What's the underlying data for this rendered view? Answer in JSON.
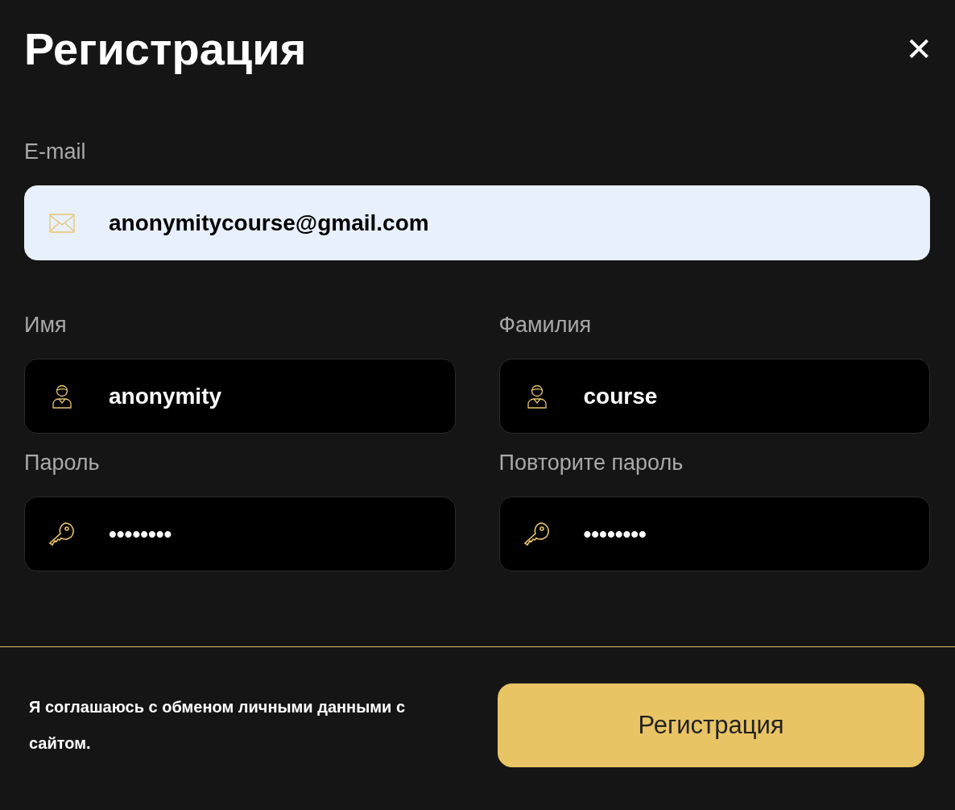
{
  "title": "Регистрация",
  "close": "✕",
  "fields": [
    {
      "label": "E-mail",
      "value": "anonymitycourse@gmail.com",
      "kind": "email",
      "autofilled": true
    },
    {
      "label": "Имя",
      "value": "anonymity",
      "kind": "name",
      "autofilled": false
    },
    {
      "label": "Фамилия",
      "value": "course",
      "kind": "name",
      "autofilled": false
    },
    {
      "label": "Пароль",
      "value": "••••••••",
      "kind": "password",
      "autofilled": false
    },
    {
      "label": "Повторите пароль",
      "value": "••••••••",
      "kind": "password",
      "autofilled": false
    }
  ],
  "consent": "Я соглашаюсь с обменом личными данными с сайтом.",
  "submit": "Регистрация"
}
